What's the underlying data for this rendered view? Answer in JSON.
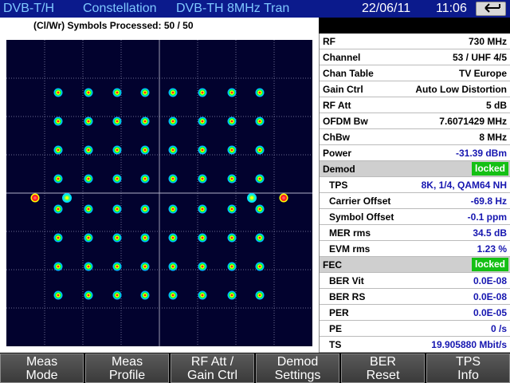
{
  "titlebar": {
    "mode": "DVB-T/H",
    "measurement": "Constellation",
    "standard": "DVB-TH 8MHz Tran",
    "date": "22/06/11",
    "time": "11:06",
    "back_icon": "back-arrow-icon"
  },
  "status": {
    "text": "(Cl/Wr) Symbols Processed:  50 / 50"
  },
  "constellation": {
    "type": "scatter",
    "modulation": "QAM64",
    "grid_size": 8,
    "clusters_per_side_visible": 8,
    "cluster_colors": [
      "#ff2020",
      "#ffff00",
      "#00ff40",
      "#00e0ff"
    ],
    "pilots": 4
  },
  "params": [
    {
      "label": "RF",
      "value": "730 MHz"
    },
    {
      "label": "Channel",
      "value": "53 / UHF 4/5"
    },
    {
      "label": "Chan Table",
      "value": "TV Europe"
    },
    {
      "label": "Gain Ctrl",
      "value": "Auto Low Distortion"
    },
    {
      "label": "RF Att",
      "value": "5 dB"
    },
    {
      "label": "OFDM Bw",
      "value": "7.6071429 MHz"
    },
    {
      "label": "ChBw",
      "value": "8 MHz"
    },
    {
      "label": "Power",
      "value": "-31.39 dBm"
    }
  ],
  "demod": {
    "title": "Demod",
    "status": "locked",
    "rows": [
      {
        "label": "TPS",
        "value": "8K, 1/4, QAM64 NH"
      },
      {
        "label": "Carrier Offset",
        "value": "-69.8 Hz"
      },
      {
        "label": "Symbol Offset",
        "value": "-0.1 ppm"
      },
      {
        "label": "MER rms",
        "value": "34.5 dB"
      },
      {
        "label": "EVM rms",
        "value": "1.23 %"
      }
    ]
  },
  "fec": {
    "title": "FEC",
    "status": "locked",
    "rows": [
      {
        "label": "BER Vit",
        "value": "0.0E-08"
      },
      {
        "label": "BER RS",
        "value": "0.0E-08"
      },
      {
        "label": "PER",
        "value": "0.0E-05"
      },
      {
        "label": "PE",
        "value": "0 /s"
      },
      {
        "label": "TS",
        "value": "19.905880 Mbit/s"
      }
    ]
  },
  "softkeys": [
    {
      "line1": "Meas",
      "line2": "Mode"
    },
    {
      "line1": "Meas",
      "line2": "Profile"
    },
    {
      "line1": "RF Att /",
      "line2": "Gain Ctrl"
    },
    {
      "line1": "Demod",
      "line2": "Settings"
    },
    {
      "line1": "BER",
      "line2": "Reset"
    },
    {
      "line1": "TPS",
      "line2": "Info"
    }
  ]
}
